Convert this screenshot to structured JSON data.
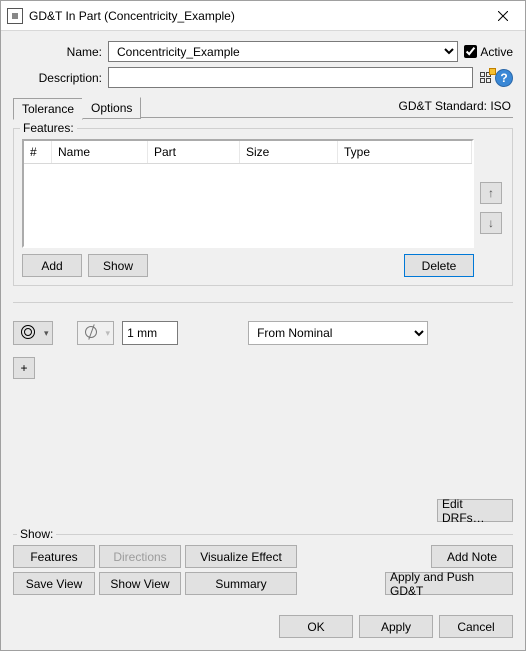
{
  "window": {
    "title": "GD&T In Part (Concentricity_Example)"
  },
  "form": {
    "name_label": "Name:",
    "name_value": "Concentricity_Example",
    "active_label": "Active",
    "description_label": "Description:",
    "description_value": ""
  },
  "tabs": {
    "tolerance": "Tolerance",
    "options": "Options"
  },
  "standard_label": "GD&T Standard: ISO",
  "features": {
    "legend": "Features:",
    "columns": {
      "num": "#",
      "name": "Name",
      "part": "Part",
      "size": "Size",
      "type": "Type"
    },
    "rows": []
  },
  "buttons": {
    "add": "Add",
    "show": "Show",
    "delete": "Delete",
    "edit_drfs": "Edit DRFs…",
    "features": "Features",
    "directions": "Directions",
    "visualize": "Visualize Effect",
    "add_note": "Add Note",
    "save_view": "Save View",
    "show_view": "Show View",
    "summary": "Summary",
    "apply_push": "Apply and Push GD&T",
    "ok": "OK",
    "apply": "Apply",
    "cancel": "Cancel",
    "plus": "+"
  },
  "tolerance": {
    "symbol": "concentricity",
    "modifier": "diameter",
    "value": "1 mm",
    "datum_source": "From Nominal"
  },
  "show_legend": "Show:",
  "arrows": {
    "up": "↑",
    "down": "↓"
  },
  "icons": {
    "concentricity": "concentricity-icon",
    "diameter": "diameter-icon",
    "grid": "grid-icon",
    "help": "?"
  }
}
